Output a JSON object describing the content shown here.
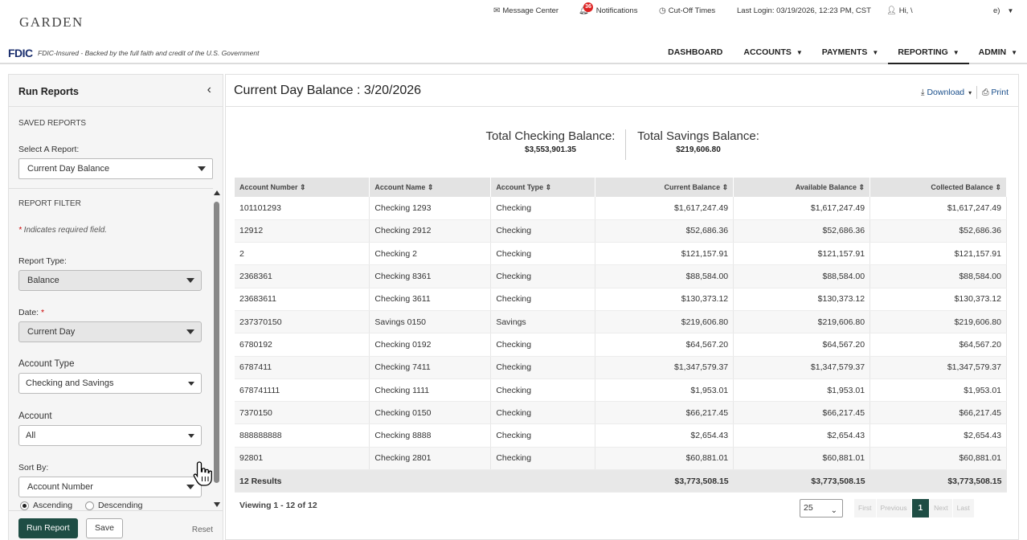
{
  "header": {
    "logo": "GARDEN",
    "message_center": "Message Center",
    "notifications_label": "Notifications",
    "notifications_count": "36",
    "cutoff": "Cut-Off Times",
    "last_login": "Last Login: 03/19/2026, 12:23 PM, CST",
    "greeting": "Hi, \\",
    "user_menu": "e)"
  },
  "fdic": {
    "logo": "FDIC",
    "text": "FDIC-Insured - Backed by the full faith and credit of the U.S. Government"
  },
  "nav": [
    {
      "label": "DASHBOARD"
    },
    {
      "label": "ACCOUNTS"
    },
    {
      "label": "PAYMENTS"
    },
    {
      "label": "REPORTING"
    },
    {
      "label": "ADMIN"
    }
  ],
  "sidebar": {
    "title": "Run Reports",
    "saved_reports": "SAVED REPORTS",
    "select_label": "Select A Report:",
    "select_value": "Current Day Balance",
    "report_filter": "REPORT FILTER",
    "required_note": "Indicates required field.",
    "report_type_label": "Report Type:",
    "report_type_value": "Balance",
    "date_label": "Date:",
    "date_value": "Current Day",
    "account_type_label": "Account Type",
    "account_type_value": "Checking and Savings",
    "account_label": "Account",
    "account_value": "All",
    "sort_label": "Sort By:",
    "sort_value": "Account Number",
    "ascending": "Ascending",
    "descending": "Descending",
    "run_button": "Run Report",
    "save_button": "Save",
    "reset": "Reset"
  },
  "main": {
    "title": "Current Day Balance : 3/20/2026",
    "download": "Download",
    "print": "Print",
    "total_checking_label": "Total Checking Balance:",
    "total_checking_value": "$3,553,901.35",
    "total_savings_label": "Total Savings Balance:",
    "total_savings_value": "$219,606.80"
  },
  "table": {
    "columns": [
      "Account Number",
      "Account Name",
      "Account Type",
      "Current Balance",
      "Available Balance",
      "Collected Balance"
    ],
    "rows": [
      [
        "101101293",
        "Checking 1293",
        "Checking",
        "$1,617,247.49",
        "$1,617,247.49",
        "$1,617,247.49"
      ],
      [
        "12912",
        "Checking 2912",
        "Checking",
        "$52,686.36",
        "$52,686.36",
        "$52,686.36"
      ],
      [
        "2",
        "Checking 2",
        "Checking",
        "$121,157.91",
        "$121,157.91",
        "$121,157.91"
      ],
      [
        "2368361",
        "Checking 8361",
        "Checking",
        "$88,584.00",
        "$88,584.00",
        "$88,584.00"
      ],
      [
        "23683611",
        "Checking 3611",
        "Checking",
        "$130,373.12",
        "$130,373.12",
        "$130,373.12"
      ],
      [
        "237370150",
        "Savings 0150",
        "Savings",
        "$219,606.80",
        "$219,606.80",
        "$219,606.80"
      ],
      [
        "6780192",
        "Checking 0192",
        "Checking",
        "$64,567.20",
        "$64,567.20",
        "$64,567.20"
      ],
      [
        "6787411",
        "Checking 7411",
        "Checking",
        "$1,347,579.37",
        "$1,347,579.37",
        "$1,347,579.37"
      ],
      [
        "678741111",
        "Checking 1111",
        "Checking",
        "$1,953.01",
        "$1,953.01",
        "$1,953.01"
      ],
      [
        "7370150",
        "Checking 0150",
        "Checking",
        "$66,217.45",
        "$66,217.45",
        "$66,217.45"
      ],
      [
        "888888888",
        "Checking 8888",
        "Checking",
        "$2,654.43",
        "$2,654.43",
        "$2,654.43"
      ],
      [
        "92801",
        "Checking 2801",
        "Checking",
        "$60,881.01",
        "$60,881.01",
        "$60,881.01"
      ]
    ],
    "footer": {
      "results": "12 Results",
      "current_total": "$3,773,508.15",
      "available_total": "$3,773,508.15",
      "collected_total": "$3,773,508.15"
    },
    "viewing": "Viewing 1 - 12 of 12",
    "per_page": "25",
    "pager": [
      "First",
      "Previous",
      "1",
      "Next",
      "Last"
    ]
  },
  "colors": {
    "accent": "#1e4d44",
    "link": "#1a4f8b",
    "notification": "#dd2222"
  }
}
